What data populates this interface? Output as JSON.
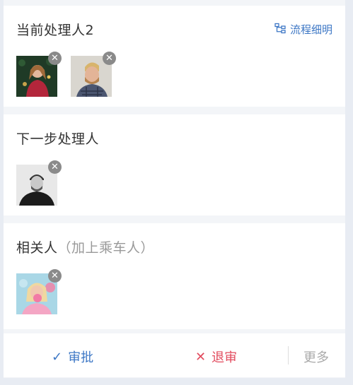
{
  "current_handlers": {
    "title": "当前处理人2",
    "flow_link": "流程细明",
    "icon": "flow-chart-icon",
    "avatars": [
      {
        "name": "avatar-woman-christmas",
        "remove": "✕"
      },
      {
        "name": "avatar-man-beard",
        "remove": "✕"
      }
    ]
  },
  "next_handlers": {
    "title": "下一步处理人",
    "avatars": [
      {
        "name": "avatar-man-bw",
        "remove": "✕"
      }
    ]
  },
  "related": {
    "title": "相关人",
    "note": "（加上乘车人）",
    "avatars": [
      {
        "name": "avatar-girl-pink",
        "remove": "✕"
      }
    ]
  },
  "footer": {
    "approve_icon": "✓",
    "approve_label": "审批",
    "reject_icon": "✕",
    "reject_label": "退审",
    "more_label": "更多"
  },
  "colors": {
    "accent": "#3d77c5",
    "danger": "#e24b5e",
    "muted": "#999999"
  }
}
